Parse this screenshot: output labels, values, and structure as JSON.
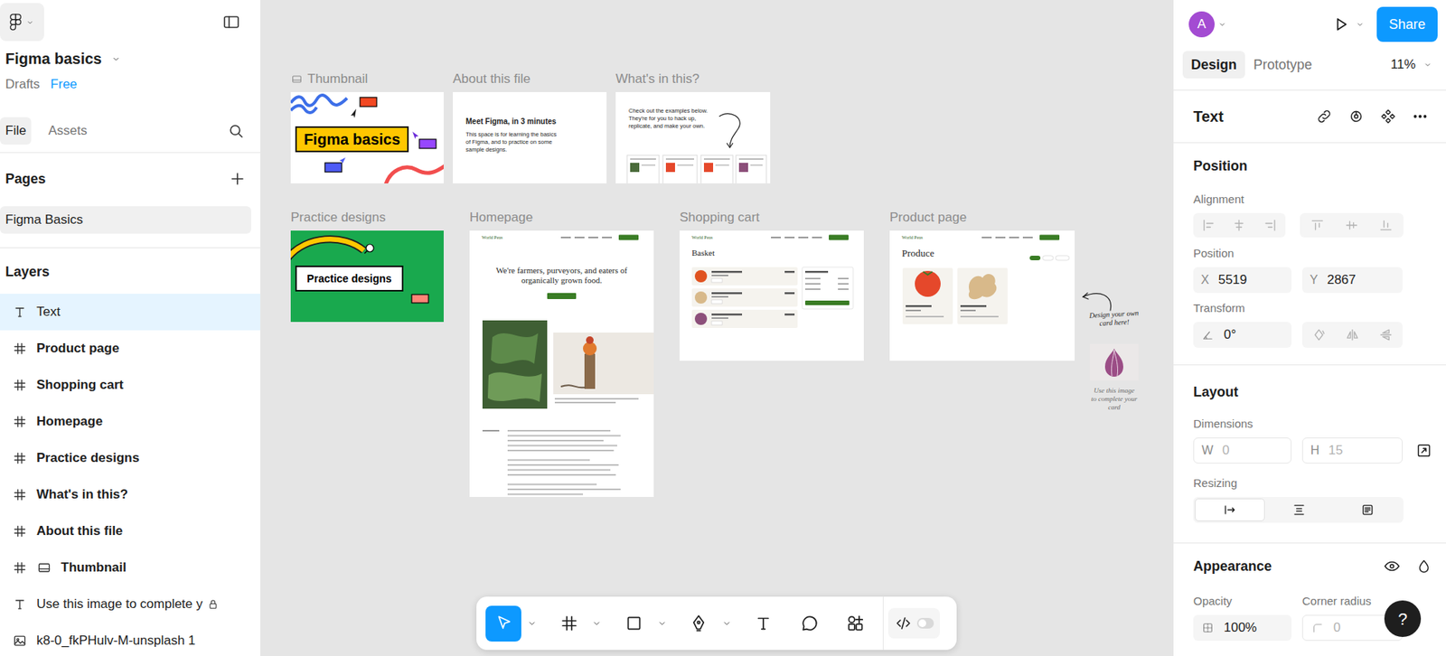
{
  "file": {
    "name": "Figma basics",
    "location": "Drafts",
    "plan": "Free"
  },
  "left_tabs": [
    {
      "label": "File",
      "selected": true
    },
    {
      "label": "Assets",
      "selected": false
    }
  ],
  "pages": {
    "title": "Pages",
    "items": [
      {
        "label": "Figma Basics",
        "selected": true
      }
    ]
  },
  "layers": {
    "title": "Layers",
    "items": [
      {
        "label": "Text",
        "kind": "text",
        "selected": true,
        "locked": false
      },
      {
        "label": "Product page",
        "kind": "frame",
        "selected": false,
        "locked": false
      },
      {
        "label": "Shopping cart",
        "kind": "frame",
        "selected": false,
        "locked": false
      },
      {
        "label": "Homepage",
        "kind": "frame",
        "selected": false,
        "locked": false
      },
      {
        "label": "Practice designs",
        "kind": "frame",
        "selected": false,
        "locked": false
      },
      {
        "label": "What's in this?",
        "kind": "frame",
        "selected": false,
        "locked": false
      },
      {
        "label": "About this file",
        "kind": "frame",
        "selected": false,
        "locked": false
      },
      {
        "label": "Thumbnail",
        "kind": "thumbnail",
        "selected": false,
        "locked": false
      },
      {
        "label": "Use this image to complete y",
        "kind": "text",
        "selected": false,
        "locked": true
      },
      {
        "label": "k8-0_fkPHulv-M-unsplash 1",
        "kind": "image",
        "selected": false,
        "locked": false
      }
    ]
  },
  "header": {
    "avatar": "A",
    "share": "Share"
  },
  "mode_tabs": [
    {
      "label": "Design",
      "selected": true
    },
    {
      "label": "Prototype",
      "selected": false
    }
  ],
  "zoom": "11%",
  "inspector": {
    "title": "Text",
    "position": {
      "title": "Position",
      "alignment_label": "Alignment",
      "position_label": "Position",
      "x_label": "X",
      "x": "5519",
      "y_label": "Y",
      "y": "2867",
      "transform_label": "Transform",
      "rotation": "0°"
    },
    "layout": {
      "title": "Layout",
      "dimensions_label": "Dimensions",
      "w_label": "W",
      "w": "0",
      "h_label": "H",
      "h": "15",
      "dimensions_disabled": true,
      "resizing_label": "Resizing",
      "resizing": [
        {
          "kind": "auto-width",
          "selected": true
        },
        {
          "kind": "auto-height",
          "selected": false
        },
        {
          "kind": "fixed",
          "selected": false
        }
      ]
    },
    "appearance": {
      "title": "Appearance",
      "opacity_label": "Opacity",
      "opacity": "100%",
      "radius_label": "Corner radius",
      "radius": "0",
      "radius_disabled": true
    }
  },
  "help": "?",
  "canvas": {
    "frames": [
      {
        "label": "Thumbnail",
        "kind": "thumbnail",
        "title": "Figma basics"
      },
      {
        "label": "About this file",
        "kind": "about",
        "heading": "Meet Figma, in 3 minutes",
        "body": "This space is for learning the basics of Figma, and to practice on some sample designs."
      },
      {
        "label": "What's in this?",
        "kind": "whats",
        "body": "Check out the examples below. They're for you to hack up, replicate, and make your own."
      },
      {
        "label": "Practice designs",
        "kind": "practice",
        "title": "Practice designs"
      },
      {
        "label": "Homepage",
        "kind": "homepage",
        "brand": "World Peas",
        "headline": "We're farmers, purveyors, and eaters of organically grown food."
      },
      {
        "label": "Shopping cart",
        "kind": "cart",
        "brand": "World Peas",
        "heading": "Basket"
      },
      {
        "label": "Product page",
        "kind": "product",
        "brand": "World Peas",
        "heading": "Produce"
      }
    ],
    "card_hint": "Design your own card here!",
    "image_hint": "Use this image to complete your card"
  },
  "toolbar": {
    "tools": [
      {
        "kind": "move",
        "selected": true,
        "dropdown": true
      },
      {
        "kind": "frame",
        "selected": false,
        "dropdown": true
      },
      {
        "kind": "rectangle",
        "selected": false,
        "dropdown": true
      },
      {
        "kind": "pen",
        "selected": false,
        "dropdown": true
      },
      {
        "kind": "text",
        "selected": false,
        "dropdown": false
      },
      {
        "kind": "comment",
        "selected": false,
        "dropdown": false
      },
      {
        "kind": "actions",
        "selected": false,
        "dropdown": false
      }
    ],
    "dev_mode": {
      "on": false
    }
  }
}
